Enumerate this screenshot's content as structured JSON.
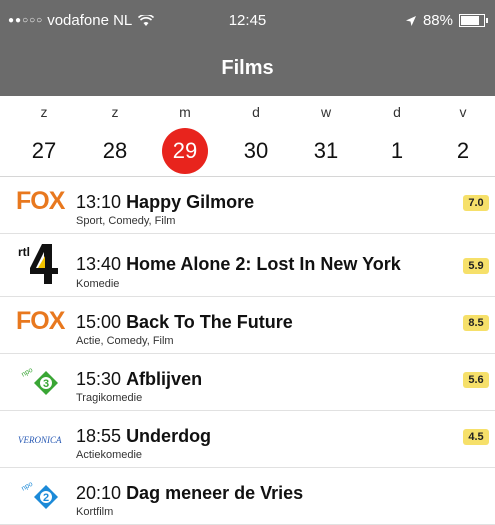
{
  "status_bar": {
    "signal_dots": "●●○○○",
    "carrier": "vodafone NL",
    "time": "12:45",
    "battery": "88%",
    "battery_level": 0.88
  },
  "nav": {
    "title": "Films"
  },
  "days": [
    {
      "dow": "z",
      "num": "27",
      "selected": false
    },
    {
      "dow": "z",
      "num": "28",
      "selected": false
    },
    {
      "dow": "m",
      "num": "29",
      "selected": true
    },
    {
      "dow": "d",
      "num": "30",
      "selected": false
    },
    {
      "dow": "w",
      "num": "31",
      "selected": false
    },
    {
      "dow": "d",
      "num": "1",
      "selected": false
    },
    {
      "dow": "v",
      "num": "2",
      "selected": false
    }
  ],
  "colors": {
    "bar": "#6b6b6b",
    "selected_day": "#e8241d",
    "rating_badge": "#f6e06a",
    "fox": "#e8781e"
  },
  "movies": [
    {
      "channel": "FOX",
      "channel_icon": "fox-logo",
      "time": "13:10",
      "title": "Happy Gilmore",
      "genre": "Sport, Comedy, Film",
      "rating": "7.0"
    },
    {
      "channel": "rtl 4",
      "channel_icon": "rtl4-logo",
      "time": "13:40",
      "title": "Home Alone 2: Lost In New York",
      "genre": "Komedie",
      "rating": "5.9"
    },
    {
      "channel": "FOX",
      "channel_icon": "fox-logo",
      "time": "15:00",
      "title": "Back To The Future",
      "genre": "Actie, Comedy, Film",
      "rating": "8.5"
    },
    {
      "channel": "npo 3",
      "channel_icon": "npo3-logo",
      "time": "15:30",
      "title": "Afblijven",
      "genre": "Tragikomedie",
      "rating": "5.6"
    },
    {
      "channel": "Veronica",
      "channel_icon": "veronica-logo",
      "time": "18:55",
      "title": "Underdog",
      "genre": "Actiekomedie",
      "rating": "4.5"
    },
    {
      "channel": "npo 2",
      "channel_icon": "npo2-logo",
      "time": "20:10",
      "title": "Dag meneer de Vries",
      "genre": "Kortfilm",
      "rating": ""
    }
  ]
}
